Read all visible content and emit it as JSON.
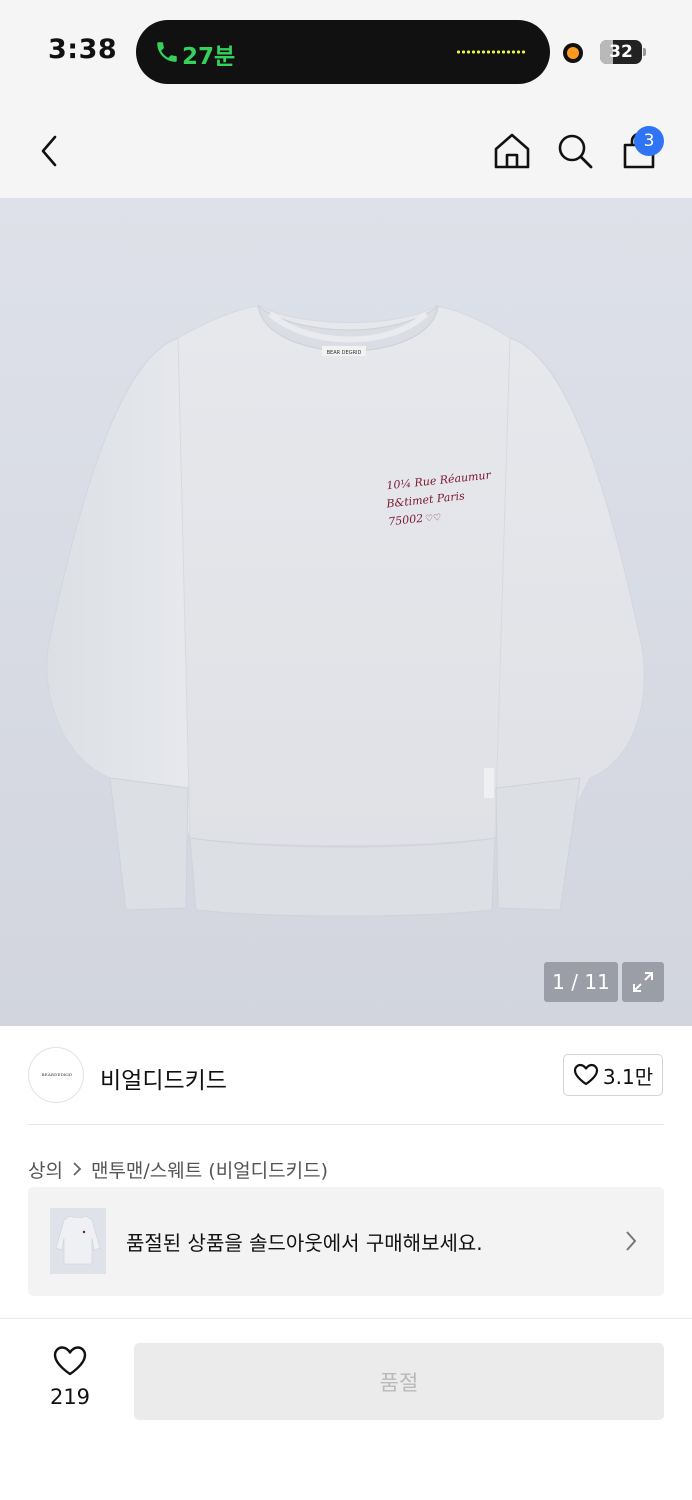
{
  "status_bar": {
    "time": "3:38",
    "call_duration": "27분",
    "battery": "32",
    "battery_level": 0.32,
    "call_color": "#34d15b"
  },
  "nav": {
    "cart_badge": "3",
    "icons": [
      "back-chevron-icon",
      "home-icon",
      "search-icon",
      "shopping-bag-icon"
    ]
  },
  "hero": {
    "image_counter": "1 / 11",
    "print_lines": [
      "10¼ Rue Réaumur",
      "B&timet Paris",
      "75002"
    ],
    "neck_label": "BEAR DEGRID"
  },
  "brand": {
    "logo_text": "BEARDEDKID",
    "name": "비얼디드키드",
    "like_count": "3.1만"
  },
  "breadcrumb": {
    "category": "상의",
    "subcategory": "맨투맨/스웨트 (비얼디드키드)"
  },
  "sold_out_banner": {
    "message": "품절된 상품을 솔드아웃에서 구매해보세요."
  },
  "bottom_bar": {
    "wish_count": "219",
    "buy_button_label": "품절"
  },
  "colors": {
    "badge": "#2f74f5",
    "disabled_button": "#ebebeb",
    "disabled_text": "#b9b9b9",
    "print_ink": "#7a1830"
  }
}
